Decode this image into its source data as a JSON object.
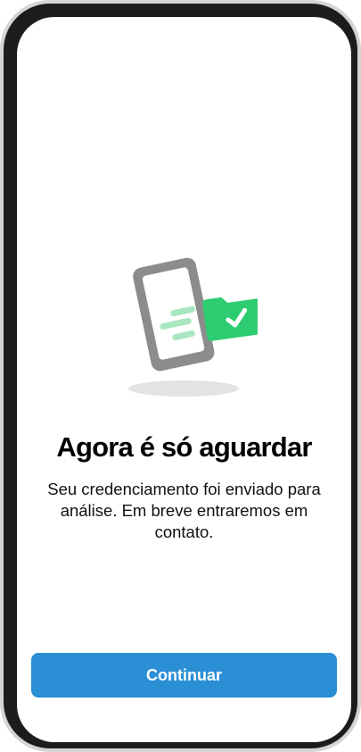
{
  "screen": {
    "title": "Agora é só aguardar",
    "message": "Seu credenciamento foi enviado para análise. Em breve entraremos em contato."
  },
  "illustration": {
    "icon": "phone-sent-document-check-icon",
    "colors": {
      "phone": "#8c8c8c",
      "folder": "#2ecc71",
      "motion_lines": "#a8e6bf",
      "shadow": "#e3e3e3"
    }
  },
  "actions": {
    "continue_label": "Continuar"
  },
  "colors": {
    "accent": "#2b8fd6",
    "title_text": "#000000",
    "body_text": "#111111"
  }
}
